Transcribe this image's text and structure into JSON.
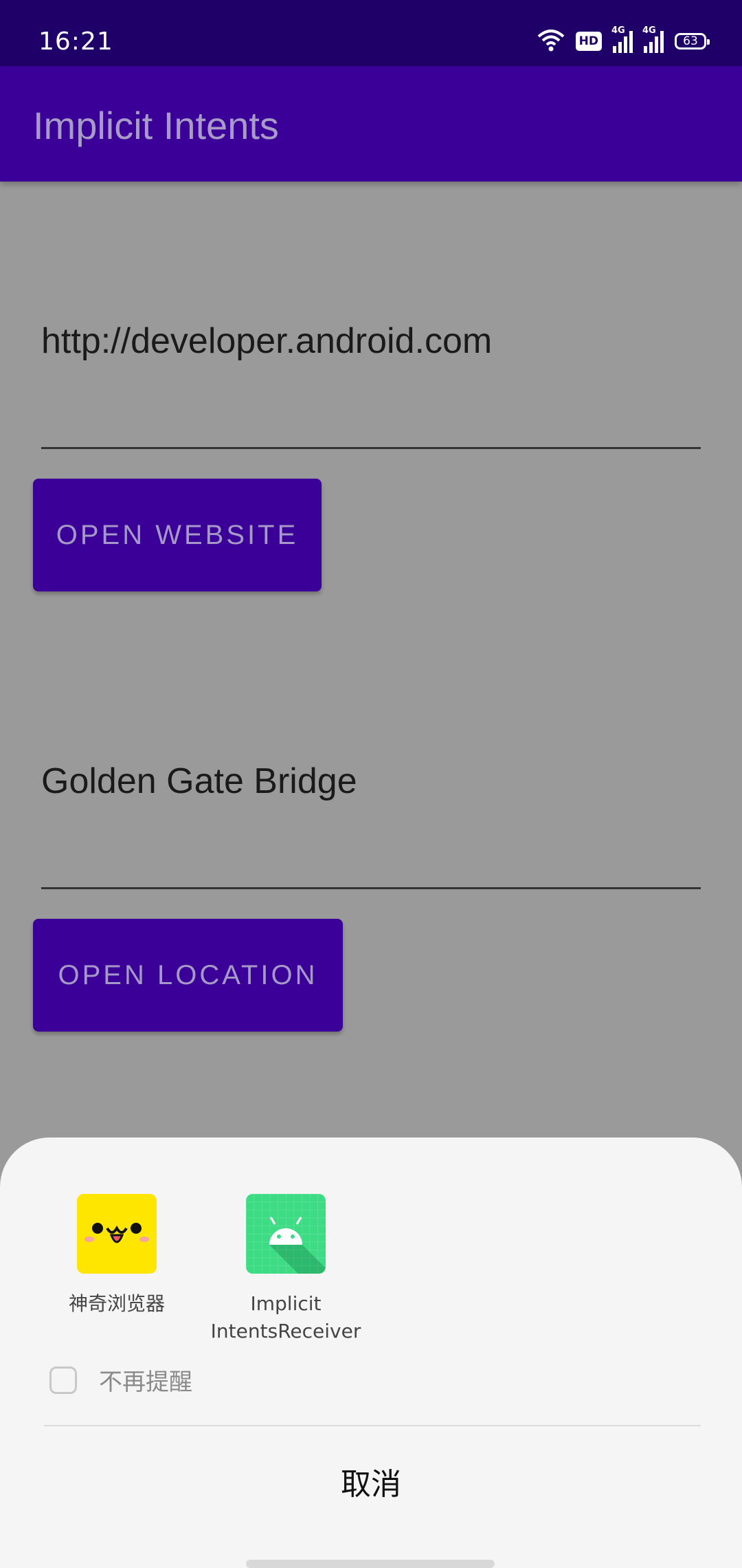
{
  "status_bar": {
    "time": "16:21",
    "hd_label": "HD",
    "network1": "4G",
    "network2": "4G",
    "battery": "63",
    "icons": [
      "wifi-icon",
      "hd-icon",
      "signal-icon",
      "signal-icon",
      "battery-icon"
    ]
  },
  "app_bar": {
    "title": "Implicit Intents"
  },
  "main": {
    "website_field": {
      "value": "http://developer.android.com"
    },
    "website_button": {
      "label": "OPEN WEBSITE"
    },
    "location_field": {
      "value": "Golden Gate Bridge"
    },
    "location_button": {
      "label": "OPEN LOCATION"
    }
  },
  "chooser": {
    "apps": [
      {
        "label": "神奇浏览器",
        "icon": "kawaii-face-icon",
        "color": "#ffe600"
      },
      {
        "label_line1": "Implicit",
        "label_line2": "IntentsReceiver",
        "icon": "android-icon",
        "color": "#3ddc84"
      }
    ],
    "dont_remind_label": "不再提醒",
    "cancel_label": "取消"
  },
  "colors": {
    "primary": "#3b0097",
    "status_bar": "#1f0068",
    "scrim_background": "#9a9a9a",
    "sheet": "#f5f5f5"
  }
}
